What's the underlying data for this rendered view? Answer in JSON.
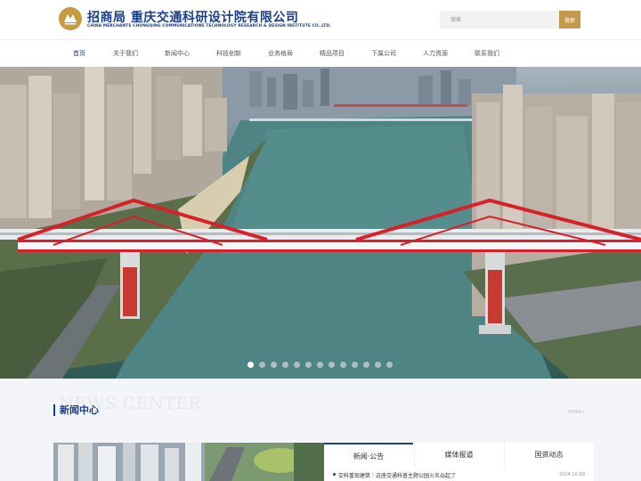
{
  "header": {
    "logo_cn": "招商局 重庆交通科研设计院有限公司",
    "logo_en": "CHINA MERCHANTS CHONGQING COMMUNICATIONS TECHNOLOGY RESEARCH & DESIGN INSTITUTE CO.,LTD.",
    "search_placeholder": "搜索",
    "search_button": "搜索"
  },
  "nav": {
    "items": [
      {
        "label": "首页",
        "active": true
      },
      {
        "label": "关于我们"
      },
      {
        "label": "新闻中心"
      },
      {
        "label": "科技创新"
      },
      {
        "label": "业务格局"
      },
      {
        "label": "精品项目"
      },
      {
        "label": "下属公司"
      },
      {
        "label": "人力资源"
      },
      {
        "label": "联系我们"
      }
    ]
  },
  "banner": {
    "slide_count": 13,
    "active_slide": 1
  },
  "news": {
    "watermark": "NEWS CENTER",
    "title": "新闻中心",
    "more": "MORE>",
    "tabs": [
      {
        "label": "新闻·公告",
        "active": true
      },
      {
        "label": "媒体报道"
      },
      {
        "label": "国资动态"
      }
    ],
    "items": [
      {
        "text": "交科重现建筑｜这座交通科普主题公园火炎焱起了",
        "date": "2024-10-09"
      }
    ]
  },
  "colors": {
    "brand_blue": "#1a3f86",
    "brand_gold": "#c39a4b",
    "bridge_red": "#d8202a"
  }
}
